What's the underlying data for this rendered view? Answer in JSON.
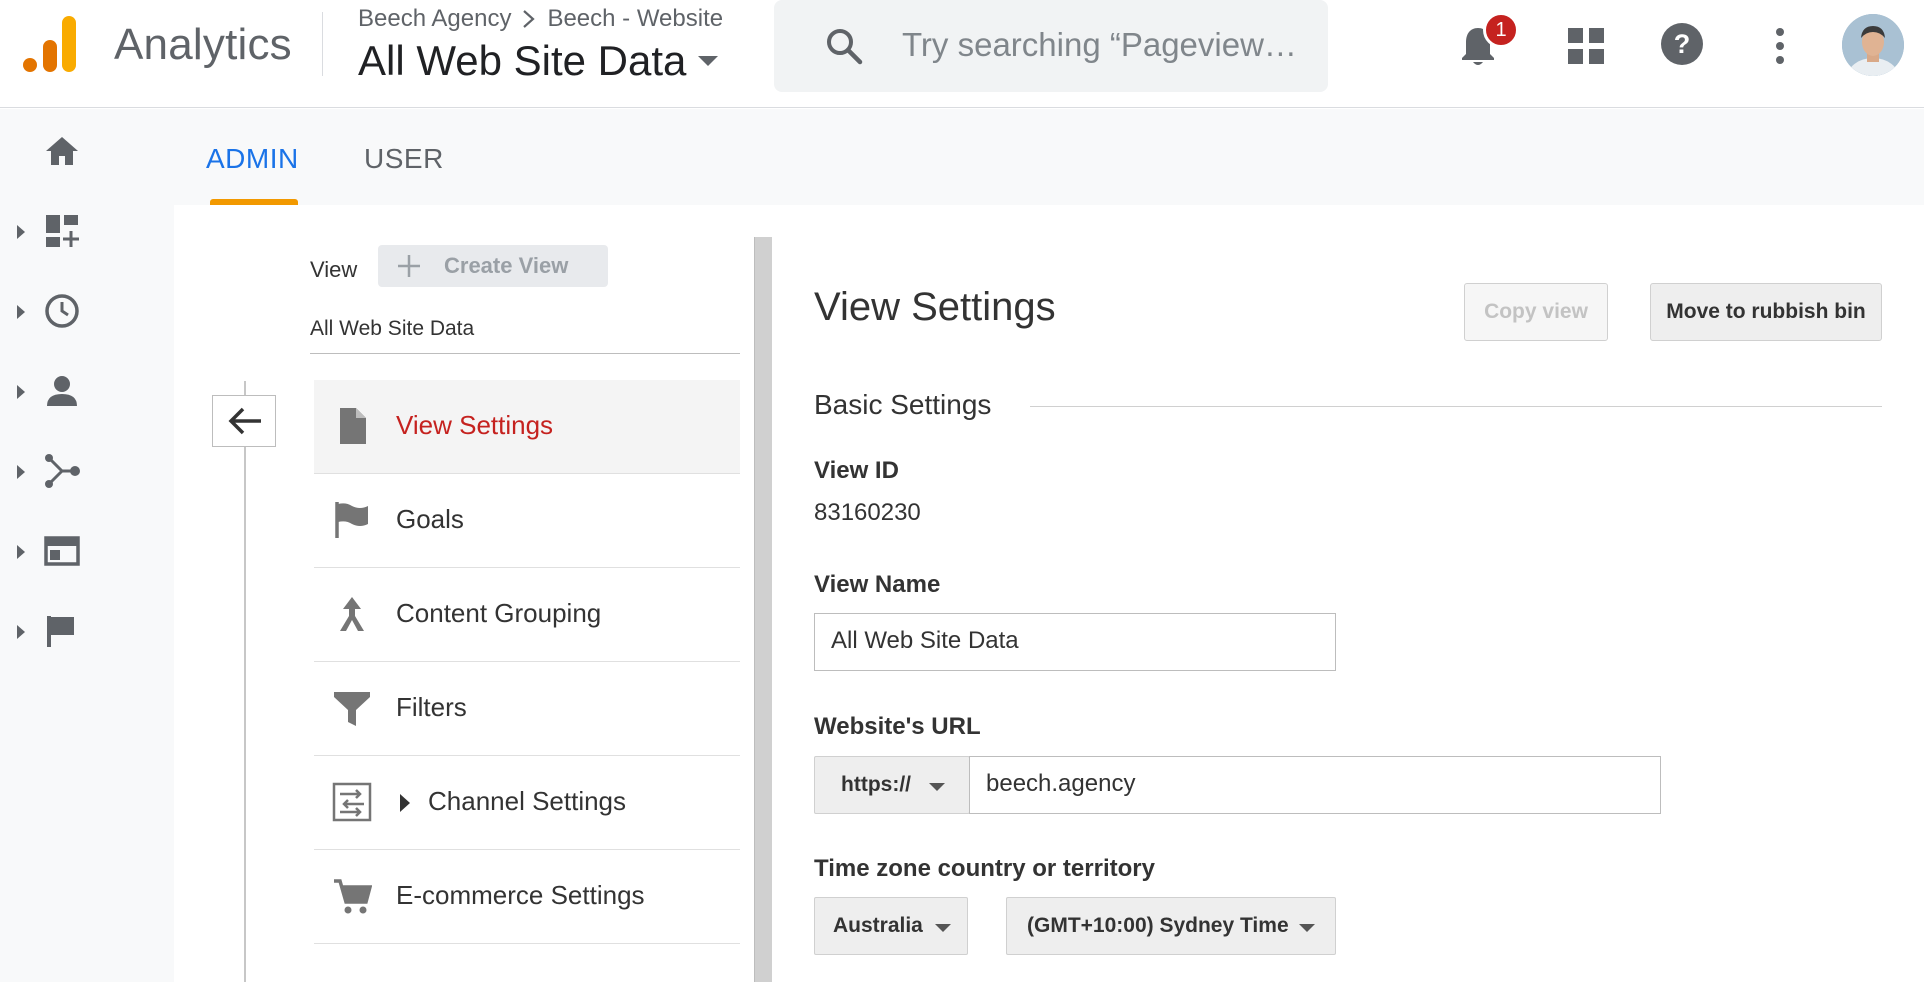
{
  "header": {
    "app_title": "Analytics",
    "breadcrumb": {
      "account": "Beech Agency",
      "property": "Beech - Website"
    },
    "view_selector": "All Web Site Data",
    "search_placeholder": "Try searching “Pageviews ...",
    "notification_count": "1",
    "colors": {
      "logo_orange": "#f9ab00",
      "logo_dark": "#e37400",
      "badge": "#c5221f"
    },
    "icons": [
      "search-icon",
      "bell-icon",
      "apps-grid-icon",
      "help-icon",
      "more-vert-icon",
      "avatar"
    ]
  },
  "rail": {
    "items": [
      {
        "icon": "home-icon",
        "expandable": false
      },
      {
        "icon": "customization-icon",
        "expandable": true
      },
      {
        "icon": "realtime-clock-icon",
        "expandable": true
      },
      {
        "icon": "audience-person-icon",
        "expandable": true
      },
      {
        "icon": "acquisition-icon",
        "expandable": true
      },
      {
        "icon": "behavior-icon",
        "expandable": true
      },
      {
        "icon": "conversions-flag-icon",
        "expandable": true
      }
    ]
  },
  "tabs": {
    "admin": "ADMIN",
    "user": "USER",
    "active": "ADMIN"
  },
  "view_column": {
    "label": "View",
    "create_view": "Create View",
    "selected_view": "All Web Site Data",
    "menu": [
      {
        "label": "View Settings",
        "icon": "document-icon",
        "active": true
      },
      {
        "label": "Goals",
        "icon": "flag-icon",
        "active": false
      },
      {
        "label": "Content Grouping",
        "icon": "content-grouping-icon",
        "active": false
      },
      {
        "label": "Filters",
        "icon": "filter-icon",
        "active": false
      },
      {
        "label": "Channel Settings",
        "icon": "channel-settings-icon",
        "active": false,
        "expandable": true
      },
      {
        "label": "E-commerce Settings",
        "icon": "cart-icon",
        "active": false
      }
    ]
  },
  "settings": {
    "title": "View Settings",
    "copy_view": "Copy view",
    "move_to_bin": "Move to rubbish bin",
    "section_title": "Basic Settings",
    "view_id_label": "View ID",
    "view_id": "83160230",
    "view_name_label": "View Name",
    "view_name": "All Web Site Data",
    "website_url_label": "Website's URL",
    "protocol": "https://",
    "website_url": "beech.agency",
    "timezone_label": "Time zone country or territory",
    "timezone_country": "Australia",
    "timezone": "(GMT+10:00) Sydney Time",
    "accent_colors": {
      "active_menu": "#c5221f",
      "active_tab": "#1a73e8",
      "tab_underline": "#f29900"
    }
  }
}
